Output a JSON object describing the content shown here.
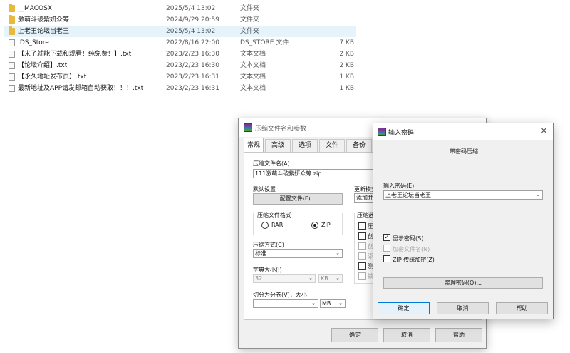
{
  "files": [
    {
      "name": "__MACOSX",
      "date": "2025/5/4 13:02",
      "type": "文件夹",
      "size": "",
      "icon": "folder-icon",
      "selected": false
    },
    {
      "name": "激萌斗破紫妍众筹",
      "date": "2024/9/29 20:59",
      "type": "文件夹",
      "size": "",
      "icon": "folder-icon",
      "selected": false
    },
    {
      "name": "上老王论坛当老王",
      "date": "2025/5/4 13:02",
      "type": "文件夹",
      "size": "",
      "icon": "folder-icon",
      "selected": true
    },
    {
      "name": ".DS_Store",
      "date": "2022/8/16 22:00",
      "type": "DS_STORE 文件",
      "size": "7 KB",
      "icon": "file-icon",
      "selected": false
    },
    {
      "name": "【来了就能下载和观看！纯免费！】.txt",
      "date": "2023/2/23 16:30",
      "type": "文本文档",
      "size": "2 KB",
      "icon": "text-file-icon",
      "selected": false
    },
    {
      "name": "【论坛介绍】.txt",
      "date": "2023/2/23 16:30",
      "type": "文本文档",
      "size": "2 KB",
      "icon": "text-file-icon",
      "selected": false
    },
    {
      "name": "【永久地址发布页】.txt",
      "date": "2023/2/23 16:31",
      "type": "文本文档",
      "size": "1 KB",
      "icon": "text-file-icon",
      "selected": false
    },
    {
      "name": "最新地址及APP请发邮箱自动获取！！！.txt",
      "date": "2023/2/23 16:31",
      "type": "文本文档",
      "size": "1 KB",
      "icon": "text-file-icon",
      "selected": false
    }
  ],
  "archive_dialog": {
    "title": "压缩文件名和参数",
    "tabs": [
      "常规",
      "高级",
      "选项",
      "文件",
      "备份"
    ],
    "archive_name_label": "压缩文件名(A)",
    "archive_name_value": "111激萌斗破紫妍众筹.zip",
    "defaults_label": "默认设置",
    "profiles_button": "配置文件(F)...",
    "update_mode_label": "更新模式",
    "update_mode_value": "添加并替",
    "format_label": "压缩文件格式",
    "format_rar": "RAR",
    "format_zip": "ZIP",
    "method_label": "压缩方式(C)",
    "method_value": "标准",
    "options_label": "压缩选",
    "dict_label": "字典大小(I)",
    "dict_value": "32",
    "dict_unit": "KB",
    "split_label": "切分为分卷(V)，大小",
    "split_value": "",
    "split_unit": "MB",
    "ok_button": "确定",
    "cancel_button": "取消",
    "help_button": "帮助",
    "option_partial_labels": [
      "压",
      "创",
      "创",
      "添",
      "测",
      "锁"
    ]
  },
  "password_dialog": {
    "title": "输入密码",
    "subtitle": "带密码压缩",
    "password_label": "输入密码(E)",
    "password_value": "上老王论坛当老王",
    "show_password": "显示密码(S)",
    "encrypt_filenames": "加密文件名(N)",
    "zip_legacy": "ZIP 传统加密(Z)",
    "organize_button": "整理密码(O)...",
    "ok_button": "确定",
    "cancel_button": "取消",
    "help_button": "帮助"
  },
  "colors": {
    "selection_bg": "#e5f3fb",
    "folder": "#e8b93c",
    "default_button_border": "#0078d7"
  }
}
